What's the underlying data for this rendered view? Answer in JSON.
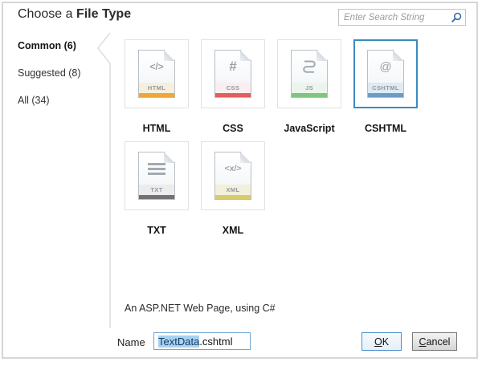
{
  "window": {
    "title_regular": "Choose a ",
    "title_bold": "File Type"
  },
  "search": {
    "placeholder": "Enter Search String",
    "icon": "magnifier-icon",
    "icon_color": "#2e6da8"
  },
  "sidebar": {
    "items": [
      {
        "label": "Common (6)",
        "selected": true
      },
      {
        "label": "Suggested (8)",
        "selected": false
      },
      {
        "label": "All (34)",
        "selected": false
      }
    ]
  },
  "file_types": [
    {
      "name": "HTML",
      "glyph": "</>",
      "badge": "HTML",
      "stripe_color": "#eda63c",
      "band_color": "#f6efdd",
      "selected": false
    },
    {
      "name": "CSS",
      "glyph": "#",
      "badge": "CSS",
      "stripe_color": "#e15f5f",
      "band_color": "#faeeee",
      "selected": false
    },
    {
      "name": "JavaScript",
      "glyph": "scroll-icon",
      "badge": "JS",
      "stripe_color": "#7fc581",
      "band_color": "#ecf5ec",
      "selected": false
    },
    {
      "name": "CSHTML",
      "glyph": "@",
      "badge": "CSHTML",
      "stripe_color": "#6a9cc8",
      "band_color": "#dfeaf4",
      "selected": true
    },
    {
      "name": "TXT",
      "glyph": "lines-icon",
      "badge": "TXT",
      "stripe_color": "#707276",
      "band_color": "#ececec",
      "selected": false
    },
    {
      "name": "XML",
      "glyph": "<x/>",
      "badge": "XML",
      "stripe_color": "#d5cd6d",
      "band_color": "#f2f0da",
      "selected": false
    }
  ],
  "description": "An ASP.NET Web Page, using C#",
  "name_field": {
    "label": "Name",
    "selected_text": "TextData",
    "suffix_text": ".cshtml"
  },
  "buttons": {
    "ok": "OK",
    "cancel": "Cancel"
  },
  "colors": {
    "selected_tile_border": "#3a8bc0",
    "selection_highlight": "#a6d2f3",
    "focused_input_border": "#6ea6d8",
    "ok_button_border": "#4d8fc9",
    "dialog_border": "#d6d6d6"
  }
}
